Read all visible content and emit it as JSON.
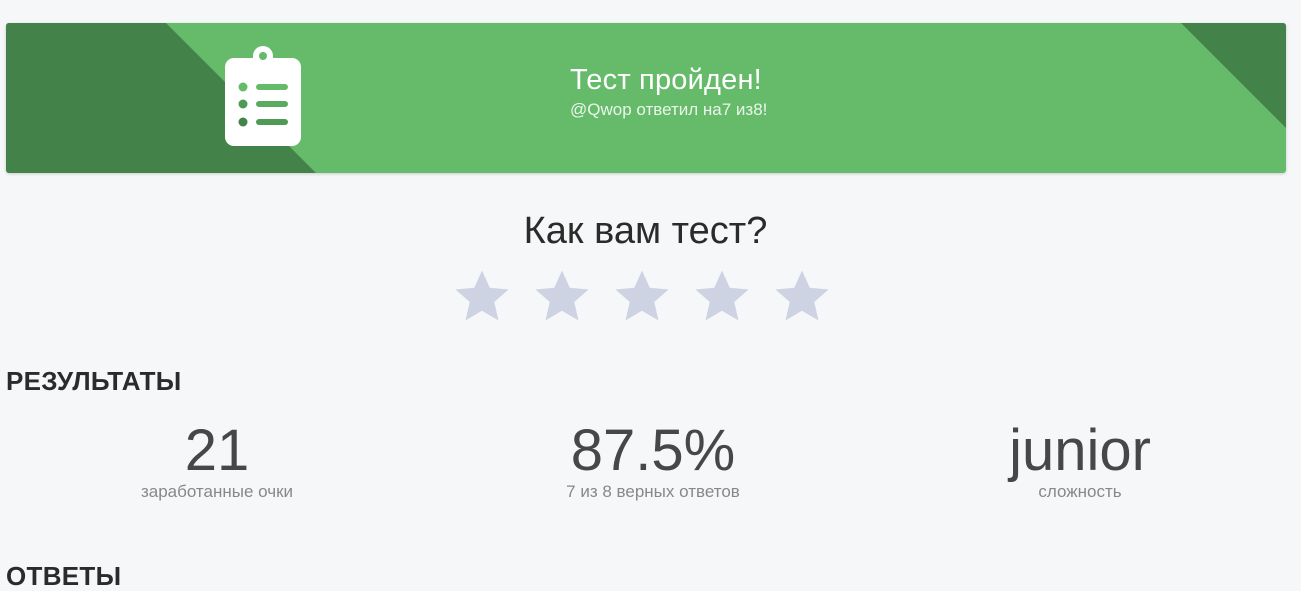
{
  "banner": {
    "title": "Тест пройден!",
    "subtitle": "@Qwop ответил на7 из8!",
    "icon": "clipboard-list-icon",
    "colors": {
      "base": "#66bb6a",
      "accent": "#43834a"
    }
  },
  "rating": {
    "title": "Как вам тест?",
    "max_stars": 5,
    "selected": 0,
    "star_color": "#cdd3e2"
  },
  "results": {
    "title": "РЕЗУЛЬТАТЫ",
    "stats": [
      {
        "value": "21",
        "label": "заработанные очки"
      },
      {
        "value": "87.5%",
        "label": "7 из 8 верных ответов"
      },
      {
        "value": "junior",
        "label": "сложность"
      }
    ]
  },
  "answers": {
    "title": "ОТВЕТЫ"
  }
}
